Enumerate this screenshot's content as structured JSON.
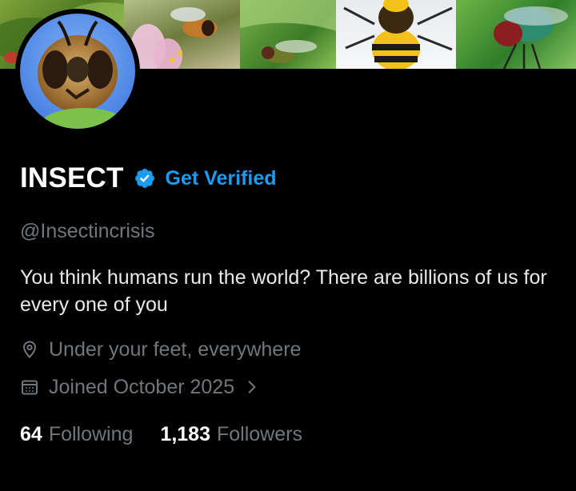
{
  "profile": {
    "display_name": "INSECT",
    "get_verified": "Get Verified",
    "handle": "@Insectincrisis",
    "bio": "You think humans run the world? There are billions of us for every one of you",
    "location": "Under your feet, everywhere",
    "joined": "Joined October 2025",
    "following_count": "64",
    "following_label": "Following",
    "followers_count": "1,183",
    "followers_label": "Followers"
  },
  "colors": {
    "background": "#000000",
    "primary_text": "#e7e9ea",
    "secondary_text": "#71767b",
    "accent": "#1d9bf0"
  },
  "icons": {
    "verified": "verified-badge-icon",
    "location": "location-pin-icon",
    "calendar": "calendar-icon",
    "chevron": "chevron-right-icon"
  }
}
